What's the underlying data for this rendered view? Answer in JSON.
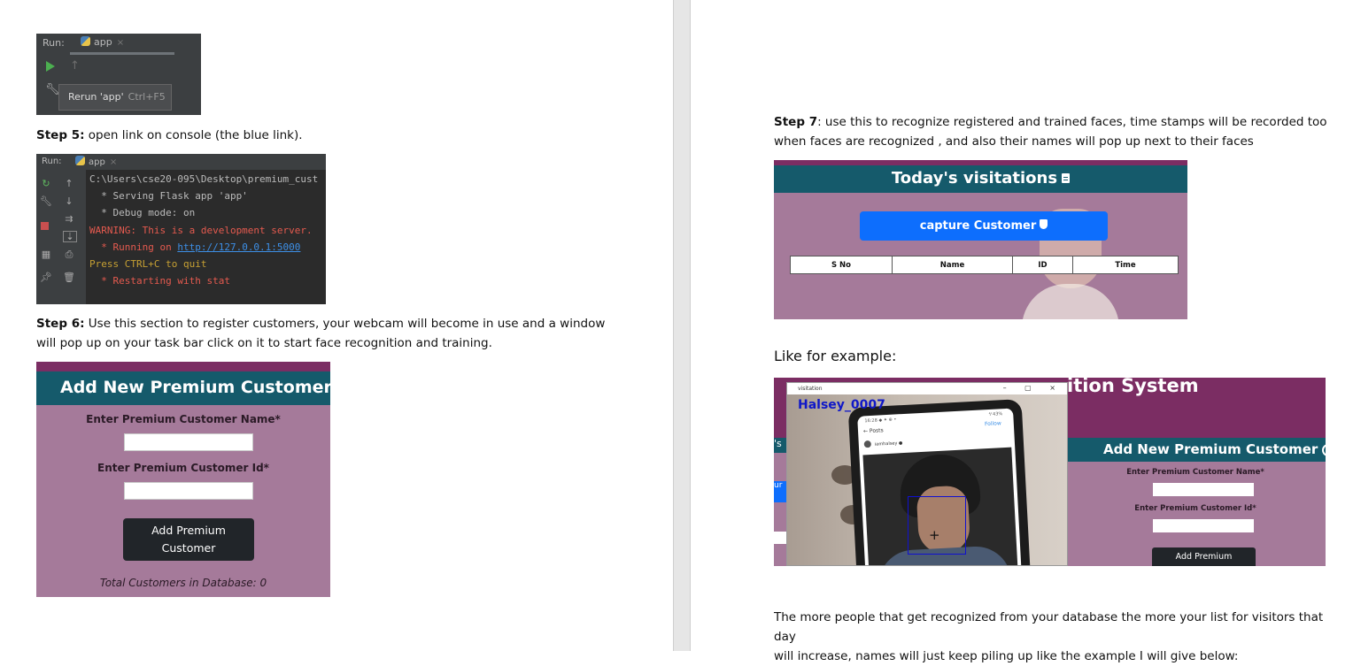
{
  "left_page": {
    "ide_run_shot": {
      "run_label": "Run:",
      "tab_label": "app",
      "tab_close": "×",
      "tooltip_text": "Rerun 'app'",
      "tooltip_shortcut": "Ctrl+F5"
    },
    "step5": {
      "bold": "Step 5:",
      "text": " open link on console (the blue link)."
    },
    "ide_console_shot": {
      "run_label": "Run:",
      "tab_label": "app",
      "tab_close": "×",
      "lines": {
        "path": "C:\\Users\\cse20-095\\Desktop\\premium_cust",
        "serving": "  * Serving Flask app 'app'",
        "debug": "  * Debug mode: on",
        "warning": "WARNING: This is a development server.",
        "running_prefix": "  * Running on ",
        "running_link": "http://127.0.0.1:5000",
        "quit": "Press CTRL+C to quit",
        "restart": "  * Restarting with stat"
      }
    },
    "step6": {
      "bold": "Step 6:",
      "line1": " Use this section to register customers, your webcam will become in use and a window",
      "line2": "will pop up on your task bar click on it to start face recognition and training."
    },
    "add_customer_shot": {
      "title": "Add New Premium Customer",
      "name_label": "Enter Premium Customer Name*",
      "id_label": "Enter Premium Customer Id*",
      "name_value": "",
      "id_value": "",
      "button_line1": "Add Premium",
      "button_line2": "Customer",
      "total": "Total Customers in Database: 0"
    }
  },
  "right_page": {
    "step7": {
      "bold": "Step 7",
      "line1": ": use this to recognize registered and trained faces, time stamps will be recorded too",
      "line2": "when faces are recognized , and also their names will pop up next to their faces"
    },
    "visitations_shot": {
      "title": "Today's visitations",
      "capture_button": "capture Customer",
      "columns": [
        "S No",
        "Name",
        "ID",
        "Time"
      ]
    },
    "example_heading": "Like for example:",
    "example_shot": {
      "bg_title": "ition System",
      "bg_title_partial": "P",
      "panel_title": "Add New Premium Customer",
      "panel_name_label": "Enter Premium Customer Name*",
      "panel_id_label": "Enter Premium Customer Id*",
      "panel_button": "Add Premium",
      "left_strip_header": "'s",
      "left_strip_button": "ur",
      "window_title": "visitation",
      "window_controls": "– ▢ ×",
      "recognized_name": "Halsey_0007",
      "phone_status": "16:28 ◆ ✦ ⊕ •",
      "phone_battery": "⁴⁄ 43%",
      "phone_back": "← Posts",
      "phone_follow": "Follow",
      "phone_user": "iamhalsey ●"
    },
    "closing": {
      "line1": "The more people that get recognized from your database the more your list for visitors that day",
      "line2": "will increase, names will just keep piling up like the example I will give below:"
    }
  },
  "colors": {
    "ide_bg": "#3c3f41",
    "console_bg": "#2b2b2b",
    "app_header": "#155a6b",
    "app_topbar": "#7b2d63",
    "app_body": "#a57a9a",
    "primary_button": "#0d6efd",
    "dark_button": "#212529",
    "face_box": "#1010d0"
  }
}
